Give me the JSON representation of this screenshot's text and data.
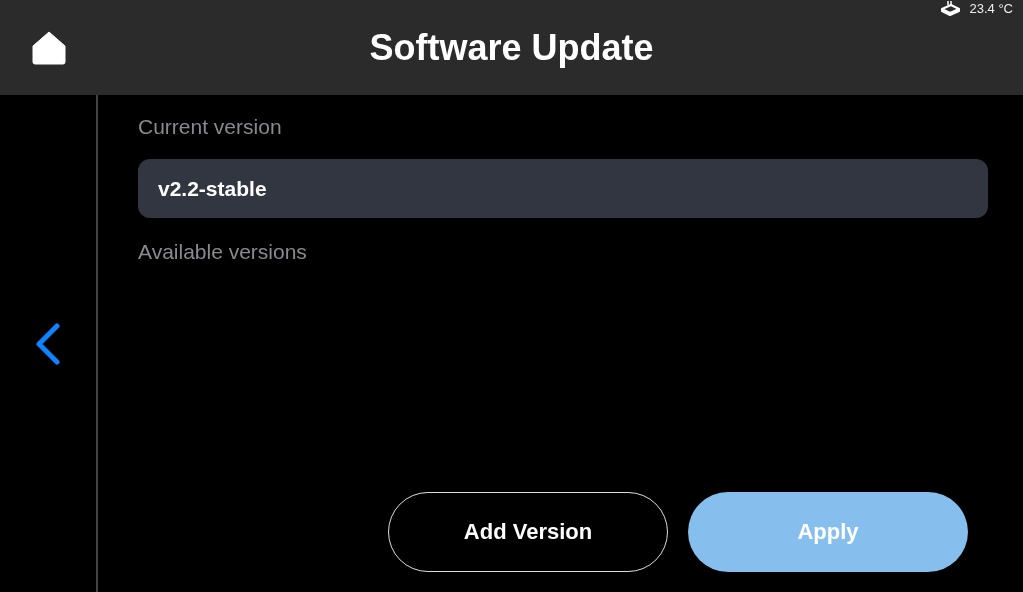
{
  "status_bar": {
    "temperature": "23.4 °C"
  },
  "header": {
    "title": "Software Update"
  },
  "current_version": {
    "label": "Current version",
    "value": "v2.2-stable"
  },
  "available_versions": {
    "label": "Available versions"
  },
  "buttons": [
    {
      "label": "Add Version",
      "kind": "outline",
      "disabled": false
    },
    {
      "label": "Apply",
      "kind": "primary",
      "disabled": true
    }
  ]
}
